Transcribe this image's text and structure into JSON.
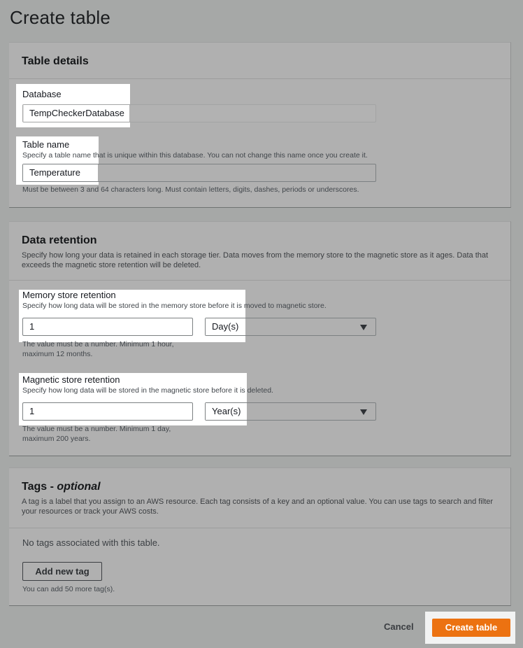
{
  "page": {
    "title": "Create table"
  },
  "table_details": {
    "title": "Table details",
    "database": {
      "label": "Database",
      "value": "TempCheckerDatabase"
    },
    "table_name": {
      "label": "Table name",
      "description": "Specify a table name that is unique within this database. You can not change this name once you create it.",
      "value": "Temperature",
      "constraint": "Must be between 3 and 64 characters long. Must contain letters, digits, dashes, periods or underscores."
    }
  },
  "data_retention": {
    "title": "Data retention",
    "description": "Specify how long your data is retained in each storage tier. Data moves from the memory store to the magnetic store as it ages. Data that exceeds the magnetic store retention will be deleted.",
    "memory": {
      "label": "Memory store retention",
      "description": "Specify how long data will be stored in the memory store before it is moved to magnetic store.",
      "value": "1",
      "unit": "Day(s)",
      "hint_line1": "The value must be a number. Minimum 1 hour,",
      "hint_line2": "maximum 12 months."
    },
    "magnetic": {
      "label": "Magnetic store retention",
      "description": "Specify how long data will be stored in the magnetic store before it is deleted.",
      "value": "1",
      "unit": "Year(s)",
      "hint_line1": "The value must be a number. Minimum 1 day,",
      "hint_line2": "maximum 200 years."
    }
  },
  "tags": {
    "title": "Tags - ",
    "title_optional": "optional",
    "description": "A tag is a label that you assign to an AWS resource. Each tag consists of a key and an optional value. You can use tags to search and filter your resources or track your AWS costs.",
    "empty_text": "No tags associated with this table.",
    "add_button": "Add new tag",
    "remaining": "You can add 50 more tag(s)."
  },
  "footer": {
    "cancel": "Cancel",
    "create": "Create table"
  },
  "colors": {
    "primary": "#ec7211",
    "overlay": "#a6a8a7",
    "highlight": "#ffffff"
  }
}
